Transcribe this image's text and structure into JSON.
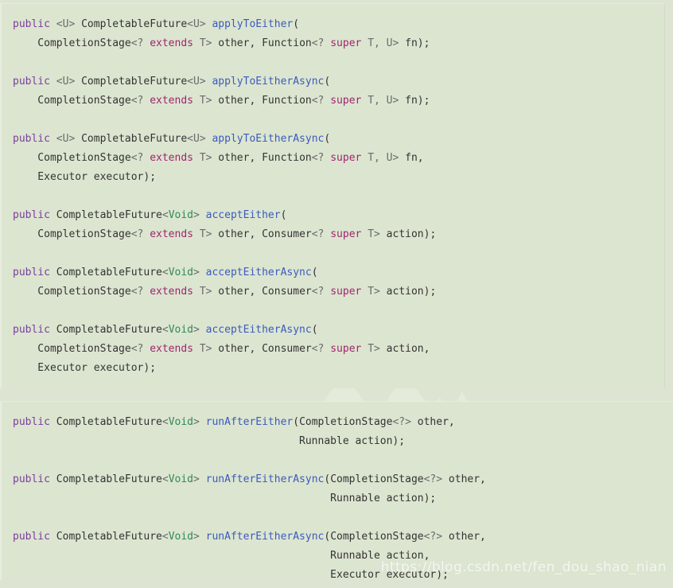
{
  "page": {
    "background_color": "#dde5d2",
    "code_block_background": "#dce5d0"
  },
  "syntax_colors": {
    "keyword": "#7a3e9d",
    "type": "#333333",
    "generic": "#6b6b6b",
    "modifier": "#a0256e",
    "void_type": "#2e8b57",
    "method_name": "#3b5bbd",
    "plain": "#333333"
  },
  "watermark": {
    "url_text": "https://blog.csdn.net/fen_dou_shao_nian",
    "logo_name": "csdn-logo-watermark"
  },
  "code_blocks": [
    {
      "id": "code-block-1",
      "language": "java",
      "lines": [
        [
          {
            "t": "public",
            "c": "kw"
          },
          {
            "t": " ",
            "c": "plain"
          },
          {
            "t": "<U>",
            "c": "generic"
          },
          {
            "t": " ",
            "c": "plain"
          },
          {
            "t": "CompletableFuture",
            "c": "type"
          },
          {
            "t": "<U>",
            "c": "generic"
          },
          {
            "t": " ",
            "c": "plain"
          },
          {
            "t": "applyToEither",
            "c": "fn"
          },
          {
            "t": "(",
            "c": "plain"
          }
        ],
        [
          {
            "t": "    CompletionStage",
            "c": "type"
          },
          {
            "t": "<?",
            "c": "generic"
          },
          {
            "t": " ",
            "c": "plain"
          },
          {
            "t": "extends",
            "c": "mod"
          },
          {
            "t": " ",
            "c": "plain"
          },
          {
            "t": "T>",
            "c": "generic"
          },
          {
            "t": " other, ",
            "c": "plain"
          },
          {
            "t": "Function",
            "c": "type"
          },
          {
            "t": "<?",
            "c": "generic"
          },
          {
            "t": " ",
            "c": "plain"
          },
          {
            "t": "super",
            "c": "mod"
          },
          {
            "t": " ",
            "c": "plain"
          },
          {
            "t": "T, U>",
            "c": "generic"
          },
          {
            "t": " fn);",
            "c": "plain"
          }
        ],
        [],
        [
          {
            "t": "public",
            "c": "kw"
          },
          {
            "t": " ",
            "c": "plain"
          },
          {
            "t": "<U>",
            "c": "generic"
          },
          {
            "t": " ",
            "c": "plain"
          },
          {
            "t": "CompletableFuture",
            "c": "type"
          },
          {
            "t": "<U>",
            "c": "generic"
          },
          {
            "t": " ",
            "c": "plain"
          },
          {
            "t": "applyToEitherAsync",
            "c": "fn"
          },
          {
            "t": "(",
            "c": "plain"
          }
        ],
        [
          {
            "t": "    CompletionStage",
            "c": "type"
          },
          {
            "t": "<?",
            "c": "generic"
          },
          {
            "t": " ",
            "c": "plain"
          },
          {
            "t": "extends",
            "c": "mod"
          },
          {
            "t": " ",
            "c": "plain"
          },
          {
            "t": "T>",
            "c": "generic"
          },
          {
            "t": " other, ",
            "c": "plain"
          },
          {
            "t": "Function",
            "c": "type"
          },
          {
            "t": "<?",
            "c": "generic"
          },
          {
            "t": " ",
            "c": "plain"
          },
          {
            "t": "super",
            "c": "mod"
          },
          {
            "t": " ",
            "c": "plain"
          },
          {
            "t": "T, U>",
            "c": "generic"
          },
          {
            "t": " fn);",
            "c": "plain"
          }
        ],
        [],
        [
          {
            "t": "public",
            "c": "kw"
          },
          {
            "t": " ",
            "c": "plain"
          },
          {
            "t": "<U>",
            "c": "generic"
          },
          {
            "t": " ",
            "c": "plain"
          },
          {
            "t": "CompletableFuture",
            "c": "type"
          },
          {
            "t": "<U>",
            "c": "generic"
          },
          {
            "t": " ",
            "c": "plain"
          },
          {
            "t": "applyToEitherAsync",
            "c": "fn"
          },
          {
            "t": "(",
            "c": "plain"
          }
        ],
        [
          {
            "t": "    CompletionStage",
            "c": "type"
          },
          {
            "t": "<?",
            "c": "generic"
          },
          {
            "t": " ",
            "c": "plain"
          },
          {
            "t": "extends",
            "c": "mod"
          },
          {
            "t": " ",
            "c": "plain"
          },
          {
            "t": "T>",
            "c": "generic"
          },
          {
            "t": " other, ",
            "c": "plain"
          },
          {
            "t": "Function",
            "c": "type"
          },
          {
            "t": "<?",
            "c": "generic"
          },
          {
            "t": " ",
            "c": "plain"
          },
          {
            "t": "super",
            "c": "mod"
          },
          {
            "t": " ",
            "c": "plain"
          },
          {
            "t": "T, U>",
            "c": "generic"
          },
          {
            "t": " fn,",
            "c": "plain"
          }
        ],
        [
          {
            "t": "    Executor",
            "c": "type"
          },
          {
            "t": " executor);",
            "c": "plain"
          }
        ],
        [],
        [
          {
            "t": "public",
            "c": "kw"
          },
          {
            "t": " ",
            "c": "plain"
          },
          {
            "t": "CompletableFuture",
            "c": "type"
          },
          {
            "t": "<",
            "c": "generic"
          },
          {
            "t": "Void",
            "c": "void"
          },
          {
            "t": ">",
            "c": "generic"
          },
          {
            "t": " ",
            "c": "plain"
          },
          {
            "t": "acceptEither",
            "c": "fn"
          },
          {
            "t": "(",
            "c": "plain"
          }
        ],
        [
          {
            "t": "    CompletionStage",
            "c": "type"
          },
          {
            "t": "<?",
            "c": "generic"
          },
          {
            "t": " ",
            "c": "plain"
          },
          {
            "t": "extends",
            "c": "mod"
          },
          {
            "t": " ",
            "c": "plain"
          },
          {
            "t": "T>",
            "c": "generic"
          },
          {
            "t": " other, ",
            "c": "plain"
          },
          {
            "t": "Consumer",
            "c": "type"
          },
          {
            "t": "<?",
            "c": "generic"
          },
          {
            "t": " ",
            "c": "plain"
          },
          {
            "t": "super",
            "c": "mod"
          },
          {
            "t": " ",
            "c": "plain"
          },
          {
            "t": "T>",
            "c": "generic"
          },
          {
            "t": " action);",
            "c": "plain"
          }
        ],
        [],
        [
          {
            "t": "public",
            "c": "kw"
          },
          {
            "t": " ",
            "c": "plain"
          },
          {
            "t": "CompletableFuture",
            "c": "type"
          },
          {
            "t": "<",
            "c": "generic"
          },
          {
            "t": "Void",
            "c": "void"
          },
          {
            "t": ">",
            "c": "generic"
          },
          {
            "t": " ",
            "c": "plain"
          },
          {
            "t": "acceptEitherAsync",
            "c": "fn"
          },
          {
            "t": "(",
            "c": "plain"
          }
        ],
        [
          {
            "t": "    CompletionStage",
            "c": "type"
          },
          {
            "t": "<?",
            "c": "generic"
          },
          {
            "t": " ",
            "c": "plain"
          },
          {
            "t": "extends",
            "c": "mod"
          },
          {
            "t": " ",
            "c": "plain"
          },
          {
            "t": "T>",
            "c": "generic"
          },
          {
            "t": " other, ",
            "c": "plain"
          },
          {
            "t": "Consumer",
            "c": "type"
          },
          {
            "t": "<?",
            "c": "generic"
          },
          {
            "t": " ",
            "c": "plain"
          },
          {
            "t": "super",
            "c": "mod"
          },
          {
            "t": " ",
            "c": "plain"
          },
          {
            "t": "T>",
            "c": "generic"
          },
          {
            "t": " action);",
            "c": "plain"
          }
        ],
        [],
        [
          {
            "t": "public",
            "c": "kw"
          },
          {
            "t": " ",
            "c": "plain"
          },
          {
            "t": "CompletableFuture",
            "c": "type"
          },
          {
            "t": "<",
            "c": "generic"
          },
          {
            "t": "Void",
            "c": "void"
          },
          {
            "t": ">",
            "c": "generic"
          },
          {
            "t": " ",
            "c": "plain"
          },
          {
            "t": "acceptEitherAsync",
            "c": "fn"
          },
          {
            "t": "(",
            "c": "plain"
          }
        ],
        [
          {
            "t": "    CompletionStage",
            "c": "type"
          },
          {
            "t": "<?",
            "c": "generic"
          },
          {
            "t": " ",
            "c": "plain"
          },
          {
            "t": "extends",
            "c": "mod"
          },
          {
            "t": " ",
            "c": "plain"
          },
          {
            "t": "T>",
            "c": "generic"
          },
          {
            "t": " other, ",
            "c": "plain"
          },
          {
            "t": "Consumer",
            "c": "type"
          },
          {
            "t": "<?",
            "c": "generic"
          },
          {
            "t": " ",
            "c": "plain"
          },
          {
            "t": "super",
            "c": "mod"
          },
          {
            "t": " ",
            "c": "plain"
          },
          {
            "t": "T>",
            "c": "generic"
          },
          {
            "t": " action,",
            "c": "plain"
          }
        ],
        [
          {
            "t": "    Executor",
            "c": "type"
          },
          {
            "t": " executor);",
            "c": "plain"
          }
        ]
      ]
    },
    {
      "id": "code-block-2",
      "language": "java",
      "lines": [
        [
          {
            "t": "public",
            "c": "kw"
          },
          {
            "t": " ",
            "c": "plain"
          },
          {
            "t": "CompletableFuture",
            "c": "type"
          },
          {
            "t": "<",
            "c": "generic"
          },
          {
            "t": "Void",
            "c": "void"
          },
          {
            "t": ">",
            "c": "generic"
          },
          {
            "t": " ",
            "c": "plain"
          },
          {
            "t": "runAfterEither",
            "c": "fn"
          },
          {
            "t": "(",
            "c": "plain"
          },
          {
            "t": "CompletionStage",
            "c": "type"
          },
          {
            "t": "<?>",
            "c": "generic"
          },
          {
            "t": " other,",
            "c": "plain"
          }
        ],
        [
          {
            "t": "                                              Runnable",
            "c": "type"
          },
          {
            "t": " action);",
            "c": "plain"
          }
        ],
        [],
        [
          {
            "t": "public",
            "c": "kw"
          },
          {
            "t": " ",
            "c": "plain"
          },
          {
            "t": "CompletableFuture",
            "c": "type"
          },
          {
            "t": "<",
            "c": "generic"
          },
          {
            "t": "Void",
            "c": "void"
          },
          {
            "t": ">",
            "c": "generic"
          },
          {
            "t": " ",
            "c": "plain"
          },
          {
            "t": "runAfterEitherAsync",
            "c": "fn"
          },
          {
            "t": "(",
            "c": "plain"
          },
          {
            "t": "CompletionStage",
            "c": "type"
          },
          {
            "t": "<?>",
            "c": "generic"
          },
          {
            "t": " other,",
            "c": "plain"
          }
        ],
        [
          {
            "t": "                                                   Runnable",
            "c": "type"
          },
          {
            "t": " action);",
            "c": "plain"
          }
        ],
        [],
        [
          {
            "t": "public",
            "c": "kw"
          },
          {
            "t": " ",
            "c": "plain"
          },
          {
            "t": "CompletableFuture",
            "c": "type"
          },
          {
            "t": "<",
            "c": "generic"
          },
          {
            "t": "Void",
            "c": "void"
          },
          {
            "t": ">",
            "c": "generic"
          },
          {
            "t": " ",
            "c": "plain"
          },
          {
            "t": "runAfterEitherAsync",
            "c": "fn"
          },
          {
            "t": "(",
            "c": "plain"
          },
          {
            "t": "CompletionStage",
            "c": "type"
          },
          {
            "t": "<?>",
            "c": "generic"
          },
          {
            "t": " other,",
            "c": "plain"
          }
        ],
        [
          {
            "t": "                                                   Runnable",
            "c": "type"
          },
          {
            "t": " action,",
            "c": "plain"
          }
        ],
        [
          {
            "t": "                                                   Executor",
            "c": "type"
          },
          {
            "t": " executor);",
            "c": "plain"
          }
        ]
      ]
    }
  ]
}
